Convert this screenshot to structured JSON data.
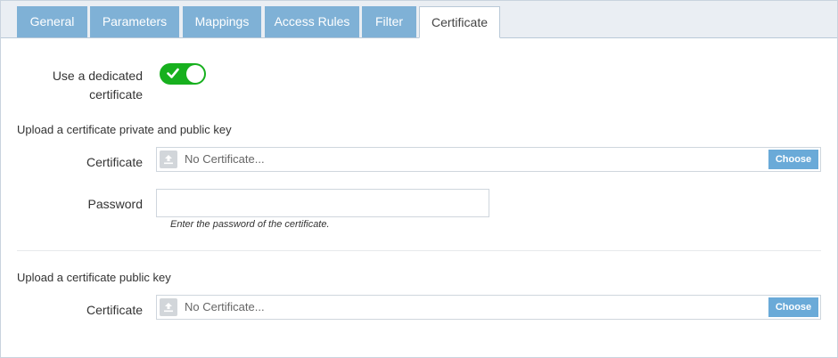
{
  "tabs": [
    {
      "label": "General"
    },
    {
      "label": "Parameters"
    },
    {
      "label": "Mappings"
    },
    {
      "label": "Access Rules"
    },
    {
      "label": "Filter"
    },
    {
      "label": "Certificate",
      "active": true
    }
  ],
  "dedicated": {
    "label_line1": "Use a dedicated",
    "label_line2": "certificate",
    "enabled": true,
    "toggle_color": "#17b01e"
  },
  "private_section": {
    "title": "Upload a certificate private and public key",
    "certificate_label": "Certificate",
    "certificate_value": "No Certificate...",
    "choose_label": "Choose",
    "password_label": "Password",
    "password_value": "",
    "password_hint": "Enter the password of the certificate."
  },
  "public_section": {
    "title": "Upload a certificate public key",
    "certificate_label": "Certificate",
    "certificate_value": "No Certificate...",
    "choose_label": "Choose"
  },
  "colors": {
    "tab_inactive": "#7fb1d6",
    "choose_button": "#6aaad8",
    "accent_green": "#17b01e"
  },
  "icons": [
    "upload-icon",
    "check-icon"
  ]
}
